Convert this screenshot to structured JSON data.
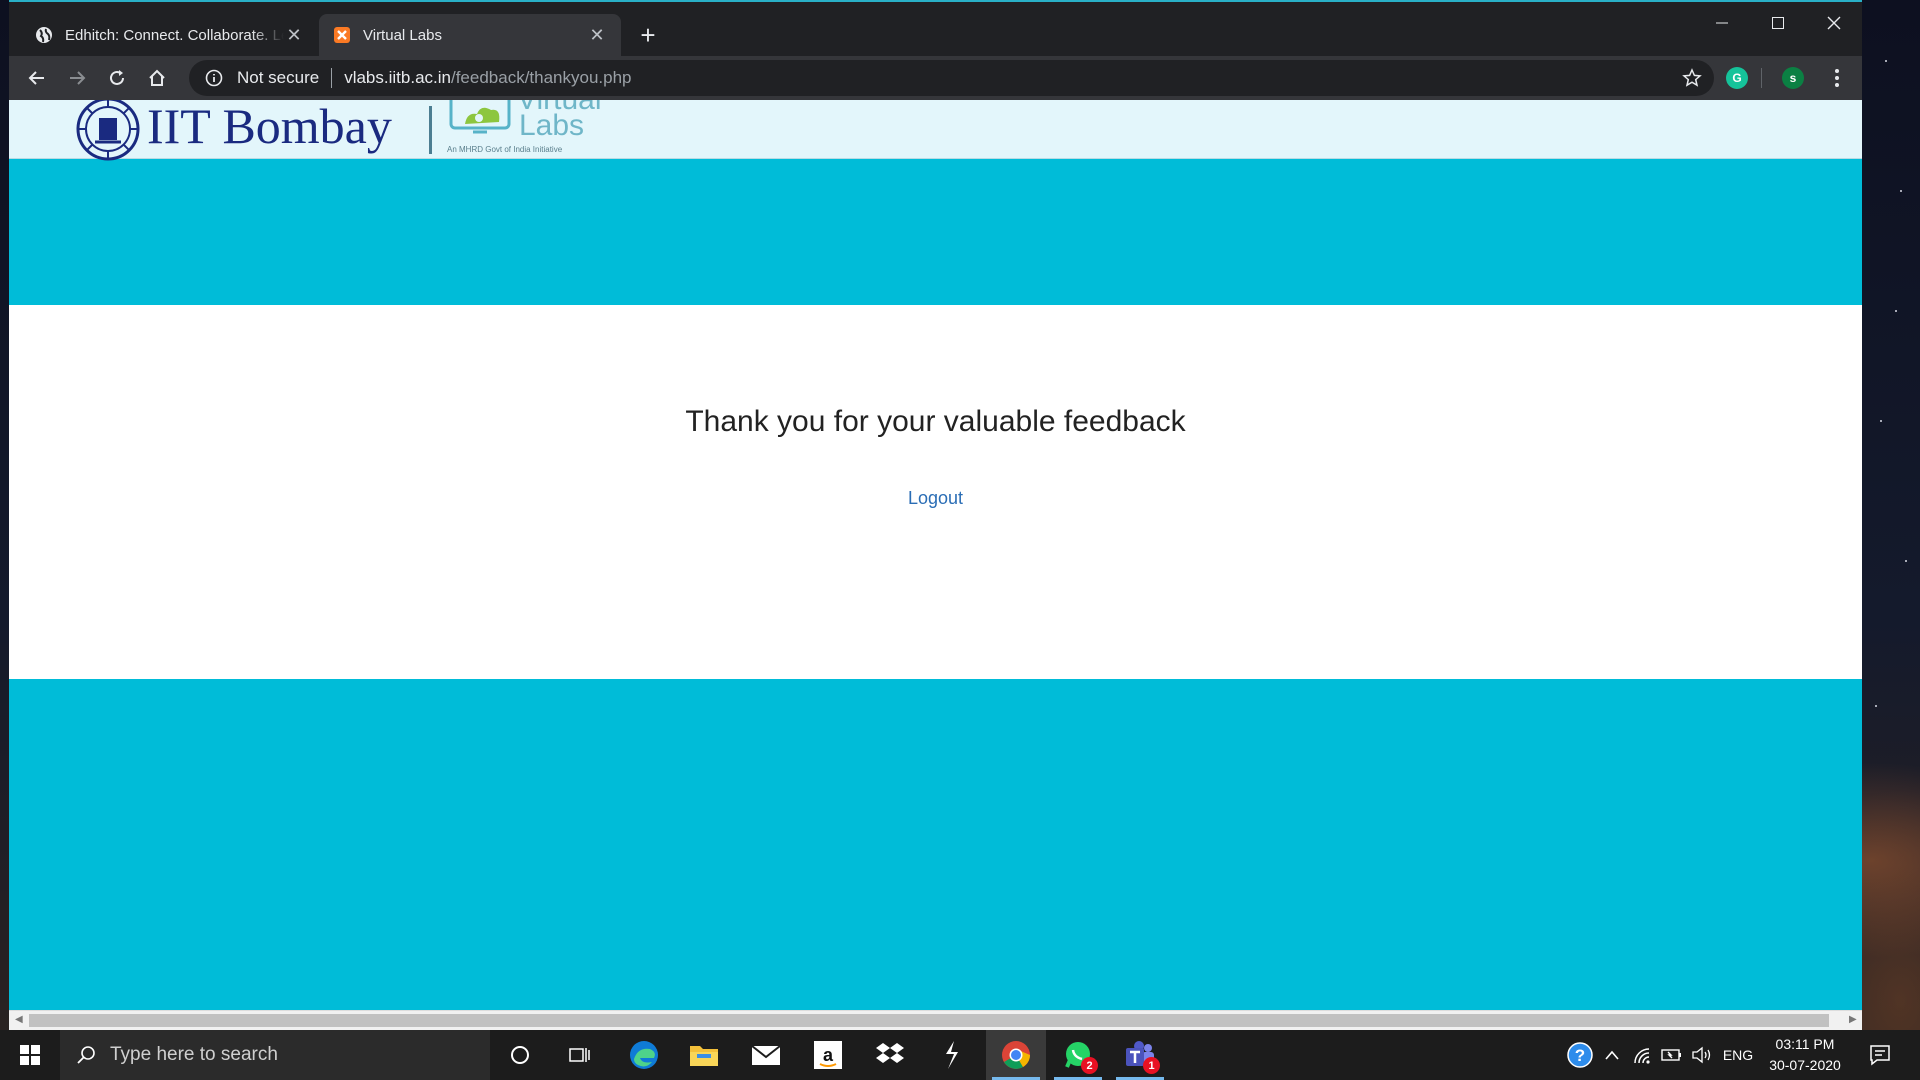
{
  "browser": {
    "tabs": [
      {
        "title": "Edhitch: Connect. Collaborate. Learn",
        "favicon": "globe-icon",
        "active": false
      },
      {
        "title": "Virtual Labs",
        "favicon": "xampp-icon",
        "active": true
      }
    ],
    "address": {
      "security_label": "Not secure",
      "domain": "vlabs.iitb.ac.in",
      "path": "/feedback/thankyou.php"
    },
    "profile_initial": "s",
    "grammarly_label": "G"
  },
  "page": {
    "header": {
      "institute_name": "IIT Bombay",
      "vlabs_line1": "Virtual",
      "vlabs_line2": "Labs",
      "vlabs_tagline": "An MHRD Govt of India Initiative"
    },
    "message": "Thank you for your valuable feedback",
    "logout_label": "Logout",
    "colors": {
      "band": "#00bcd8",
      "panel": "#ffffff",
      "link": "#2a6db5"
    }
  },
  "taskbar": {
    "search_placeholder": "Type here to search",
    "whatsapp_badge": "2",
    "teams_badge": "1",
    "language": "ENG",
    "time": "03:11 PM",
    "date": "30-07-2020"
  }
}
